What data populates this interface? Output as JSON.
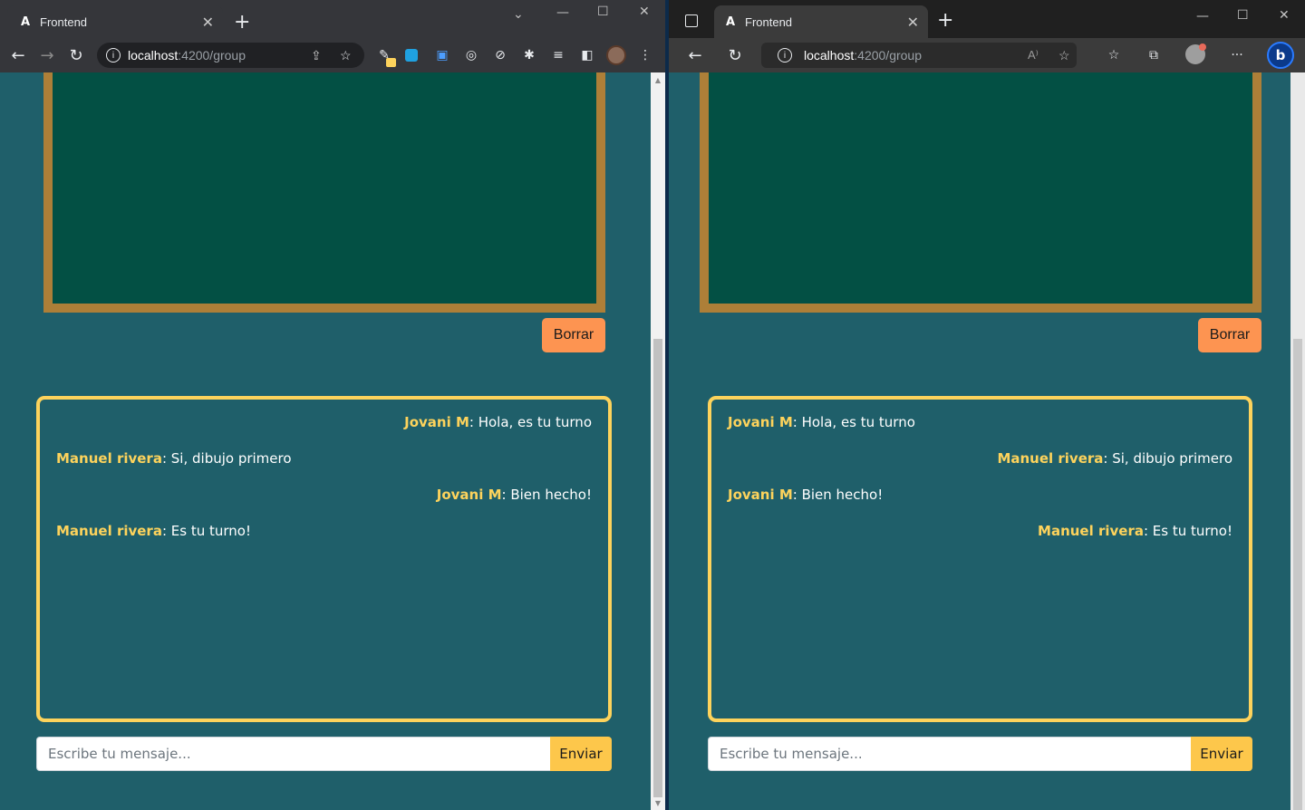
{
  "left_browser": {
    "tab_title": "Frontend",
    "url_host": "localhost",
    "url_path": ":4200/group"
  },
  "right_browser": {
    "tab_title": "Frontend",
    "url_host": "localhost",
    "url_path": ":4200/group"
  },
  "colors": {
    "page_bg": "#1f5f6a",
    "board": "#035044",
    "board_frame": "#ad7f38",
    "accent": "#fdd35c",
    "borrar": "#fd9451",
    "send": "#fdc74b"
  },
  "left_page": {
    "clear_label": "Borrar",
    "messages": [
      {
        "user": "Jovani M",
        "text": ": Hola, es tu turno",
        "align": "right"
      },
      {
        "user": "Manuel rivera",
        "text": ": Si, dibujo primero",
        "align": "left"
      },
      {
        "user": "Jovani M",
        "text": ": Bien hecho!",
        "align": "right"
      },
      {
        "user": "Manuel rivera",
        "text": ": Es tu turno!",
        "align": "left"
      }
    ],
    "input_placeholder": "Escribe tu mensaje...",
    "send_label": "Enviar"
  },
  "right_page": {
    "clear_label": "Borrar",
    "messages": [
      {
        "user": "Jovani M",
        "text": ": Hola, es tu turno",
        "align": "left"
      },
      {
        "user": "Manuel rivera",
        "text": ": Si, dibujo primero",
        "align": "right"
      },
      {
        "user": "Jovani M",
        "text": ": Bien hecho!",
        "align": "left"
      },
      {
        "user": "Manuel rivera",
        "text": ": Es tu turno!",
        "align": "right"
      }
    ],
    "input_placeholder": "Escribe tu mensaje...",
    "send_label": "Enviar"
  }
}
